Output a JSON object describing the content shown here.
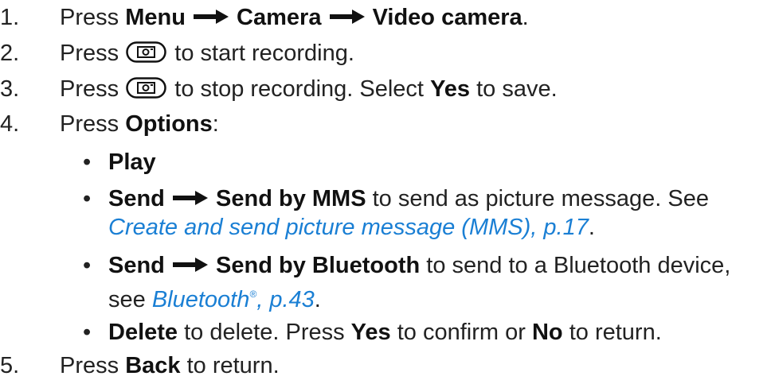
{
  "steps": [
    {
      "num": "1.",
      "press": "Press",
      "menu": "Menu",
      "camera": "Camera",
      "video_camera": "Video camera",
      "end": "."
    },
    {
      "num": "2.",
      "press": "Press",
      "rest": "to start recording."
    },
    {
      "num": "3.",
      "press": "Press",
      "rest": "to stop recording. Select",
      "yes": "Yes",
      "rest2": "to save."
    },
    {
      "num": "4.",
      "press": "Press",
      "options": "Options",
      "colon": ":"
    },
    {
      "num": "5.",
      "press": "Press",
      "back": "Back",
      "rest": "to return."
    }
  ],
  "options": {
    "bullet": "•",
    "play": "Play",
    "mms": {
      "send": "Send",
      "by": "Send by MMS",
      "rest": "to send as picture message. See",
      "link": "Create and send picture message (MMS), p.17",
      "end": "."
    },
    "bt": {
      "send": "Send",
      "by": "Send by Bluetooth",
      "rest": "to send to a Bluetooth device,",
      "see": "see",
      "link_a": "Bluetooth",
      "reg": "®",
      "link_b": ", p.43",
      "end": "."
    },
    "delete": {
      "label": "Delete",
      "rest": "to delete. Press",
      "yes": "Yes",
      "mid": "to confirm or",
      "no": "No",
      "end": "to return."
    }
  },
  "colors": {
    "link": "#1a7fd4",
    "text": "#222222"
  },
  "icons": [
    "arrow-icon",
    "camera-key-icon"
  ]
}
